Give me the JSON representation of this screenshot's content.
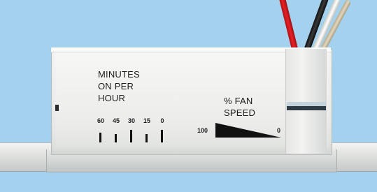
{
  "minutes_label": {
    "line1": "MINUTES",
    "line2": "ON PER",
    "line3": "HOUR"
  },
  "minute_ticks": [
    "60",
    "45",
    "30",
    "15",
    "0"
  ],
  "fan_label": {
    "line1": "% FAN",
    "line2": "SPEED"
  },
  "fan_scale": {
    "max": "100",
    "min": "0"
  },
  "colors": {
    "background": "#a4d2ee",
    "housing": "#ecedeb",
    "print": "#1d1d1d",
    "wire_red": "#e52228",
    "wire_black": "#111111",
    "wire_white": "#ffffff"
  }
}
